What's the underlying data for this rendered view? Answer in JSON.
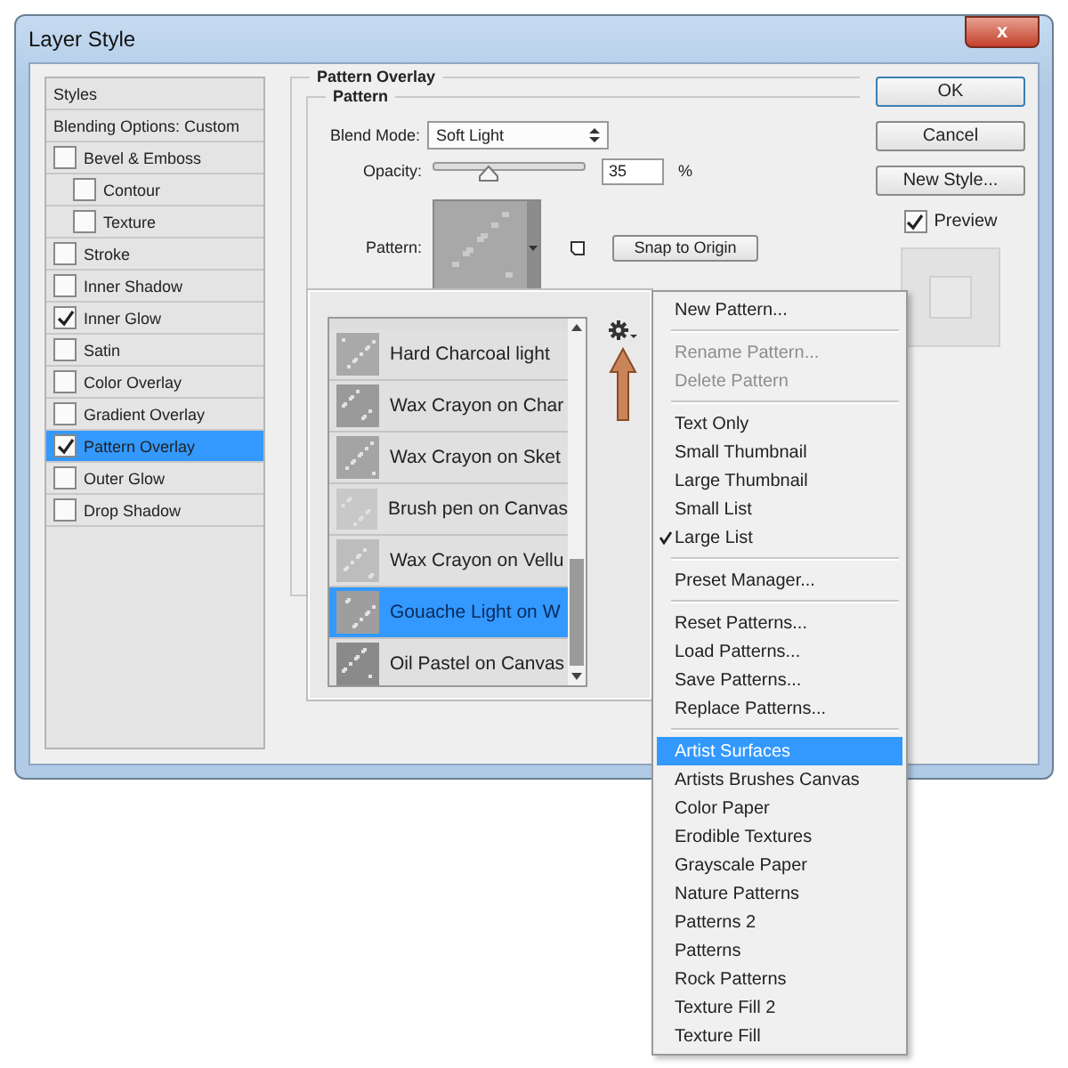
{
  "window": {
    "title": "Layer Style",
    "close": "x"
  },
  "styles_panel": {
    "header": "Styles",
    "blending": "Blending Options: Custom",
    "items": [
      {
        "label": "Bevel & Emboss",
        "checked": false,
        "selected": false,
        "children": [
          {
            "label": "Contour",
            "checked": false,
            "selected": false
          },
          {
            "label": "Texture",
            "checked": false,
            "selected": false
          }
        ]
      },
      {
        "label": "Stroke",
        "checked": false,
        "selected": false
      },
      {
        "label": "Inner Shadow",
        "checked": false,
        "selected": false
      },
      {
        "label": "Inner Glow",
        "checked": true,
        "selected": false
      },
      {
        "label": "Satin",
        "checked": false,
        "selected": false
      },
      {
        "label": "Color Overlay",
        "checked": false,
        "selected": false
      },
      {
        "label": "Gradient Overlay",
        "checked": false,
        "selected": false
      },
      {
        "label": "Pattern Overlay",
        "checked": true,
        "selected": true
      },
      {
        "label": "Outer Glow",
        "checked": false,
        "selected": false
      },
      {
        "label": "Drop Shadow",
        "checked": false,
        "selected": false
      }
    ]
  },
  "pattern_overlay": {
    "title": "Pattern Overlay",
    "group": "Pattern",
    "blend_mode": {
      "label": "Blend Mode:",
      "value": "Soft Light"
    },
    "opacity": {
      "label": "Opacity:",
      "level": 0.36,
      "value": "35",
      "unit": "%"
    },
    "pattern": {
      "label": "Pattern:"
    },
    "snap_button": "Snap to Origin"
  },
  "pattern_picker": {
    "items": [
      {
        "label": "Hard Charcoal light",
        "selected": false
      },
      {
        "label": "Wax Crayon on Char",
        "selected": false
      },
      {
        "label": "Wax Crayon on Sket",
        "selected": false
      },
      {
        "label": "Brush pen on Canvas",
        "selected": false
      },
      {
        "label": "Wax Crayon on Vellu",
        "selected": false
      },
      {
        "label": "Gouache Light on W",
        "selected": true
      },
      {
        "label": "Oil Pastel on Canvas",
        "selected": false
      }
    ]
  },
  "menu": {
    "groups": [
      [
        {
          "label": "New Pattern...",
          "disabled": false,
          "checked": false,
          "selected": false
        }
      ],
      [
        {
          "label": "Rename Pattern...",
          "disabled": true,
          "checked": false,
          "selected": false
        },
        {
          "label": "Delete Pattern",
          "disabled": true,
          "checked": false,
          "selected": false
        }
      ],
      [
        {
          "label": "Text Only",
          "disabled": false,
          "checked": false,
          "selected": false
        },
        {
          "label": "Small Thumbnail",
          "disabled": false,
          "checked": false,
          "selected": false
        },
        {
          "label": "Large Thumbnail",
          "disabled": false,
          "checked": false,
          "selected": false
        },
        {
          "label": "Small List",
          "disabled": false,
          "checked": false,
          "selected": false
        },
        {
          "label": "Large List",
          "disabled": false,
          "checked": true,
          "selected": false
        }
      ],
      [
        {
          "label": "Preset Manager...",
          "disabled": false,
          "checked": false,
          "selected": false
        }
      ],
      [
        {
          "label": "Reset Patterns...",
          "disabled": false,
          "checked": false,
          "selected": false
        },
        {
          "label": "Load Patterns...",
          "disabled": false,
          "checked": false,
          "selected": false
        },
        {
          "label": "Save Patterns...",
          "disabled": false,
          "checked": false,
          "selected": false
        },
        {
          "label": "Replace Patterns...",
          "disabled": false,
          "checked": false,
          "selected": false
        }
      ],
      [
        {
          "label": "Artist Surfaces",
          "disabled": false,
          "checked": false,
          "selected": true
        },
        {
          "label": "Artists Brushes Canvas",
          "disabled": false,
          "checked": false,
          "selected": false
        },
        {
          "label": "Color Paper",
          "disabled": false,
          "checked": false,
          "selected": false
        },
        {
          "label": "Erodible Textures",
          "disabled": false,
          "checked": false,
          "selected": false
        },
        {
          "label": "Grayscale Paper",
          "disabled": false,
          "checked": false,
          "selected": false
        },
        {
          "label": "Nature Patterns",
          "disabled": false,
          "checked": false,
          "selected": false
        },
        {
          "label": "Patterns 2",
          "disabled": false,
          "checked": false,
          "selected": false
        },
        {
          "label": "Patterns",
          "disabled": false,
          "checked": false,
          "selected": false
        },
        {
          "label": "Rock Patterns",
          "disabled": false,
          "checked": false,
          "selected": false
        },
        {
          "label": "Texture Fill 2",
          "disabled": false,
          "checked": false,
          "selected": false
        },
        {
          "label": "Texture Fill",
          "disabled": false,
          "checked": false,
          "selected": false
        }
      ]
    ]
  },
  "buttons": [
    "OK",
    "Cancel",
    "New Style..."
  ],
  "preview": {
    "label": "Preview",
    "checked": true
  }
}
